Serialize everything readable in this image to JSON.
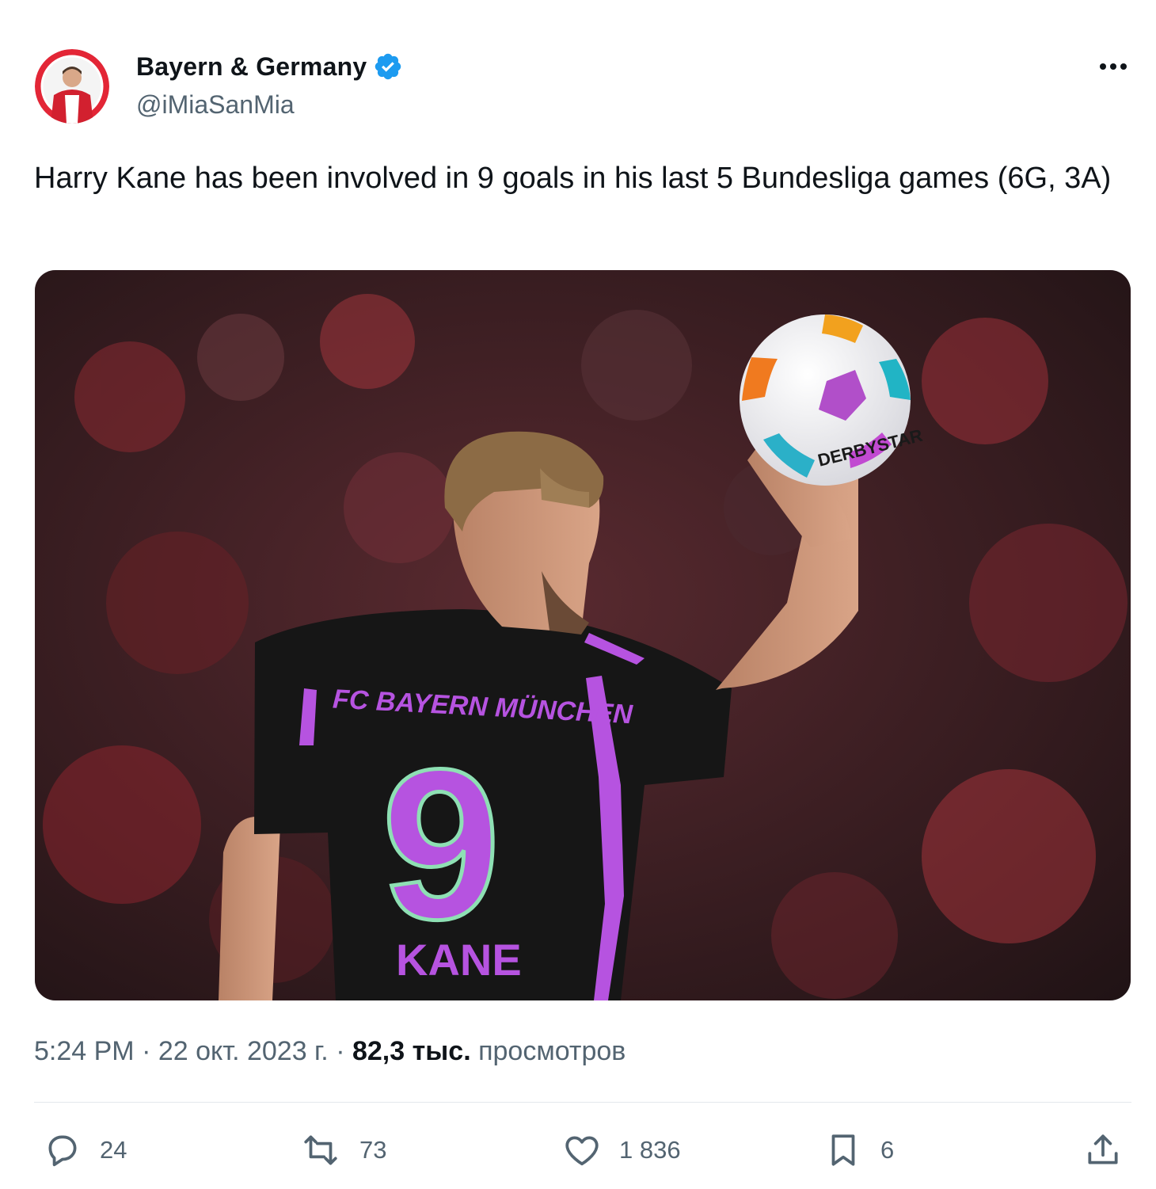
{
  "author": {
    "display_name": "Bayern & Germany",
    "handle": "@iMiaSanMia",
    "verified": true,
    "verified_color": "#1d9bf0"
  },
  "post": {
    "text": "Harry Kane has been involved in 9 goals in his last 5 Bundesliga games (6G, 3A)"
  },
  "media": {
    "jersey_club_text": "FC BAYERN MÜNCHEN",
    "jersey_number": "9",
    "jersey_name": "KANE",
    "ball_brand": "DERBYSTAR"
  },
  "meta": {
    "time": "5:24 PM",
    "separator1": " · ",
    "date": "22 окт. 2023 г.",
    "separator2": " · ",
    "views_count": "82,3 тыс.",
    "views_label": " просмотров"
  },
  "actions": {
    "replies": "24",
    "reposts": "73",
    "likes": "1 836",
    "bookmarks": "6"
  },
  "icons": [
    "verified-badge-icon",
    "more-icon",
    "reply-icon",
    "repost-icon",
    "like-icon",
    "bookmark-icon",
    "share-icon"
  ],
  "colors": {
    "text_primary": "#0f1419",
    "text_secondary": "#536471",
    "jersey_purple": "#b653e0"
  }
}
